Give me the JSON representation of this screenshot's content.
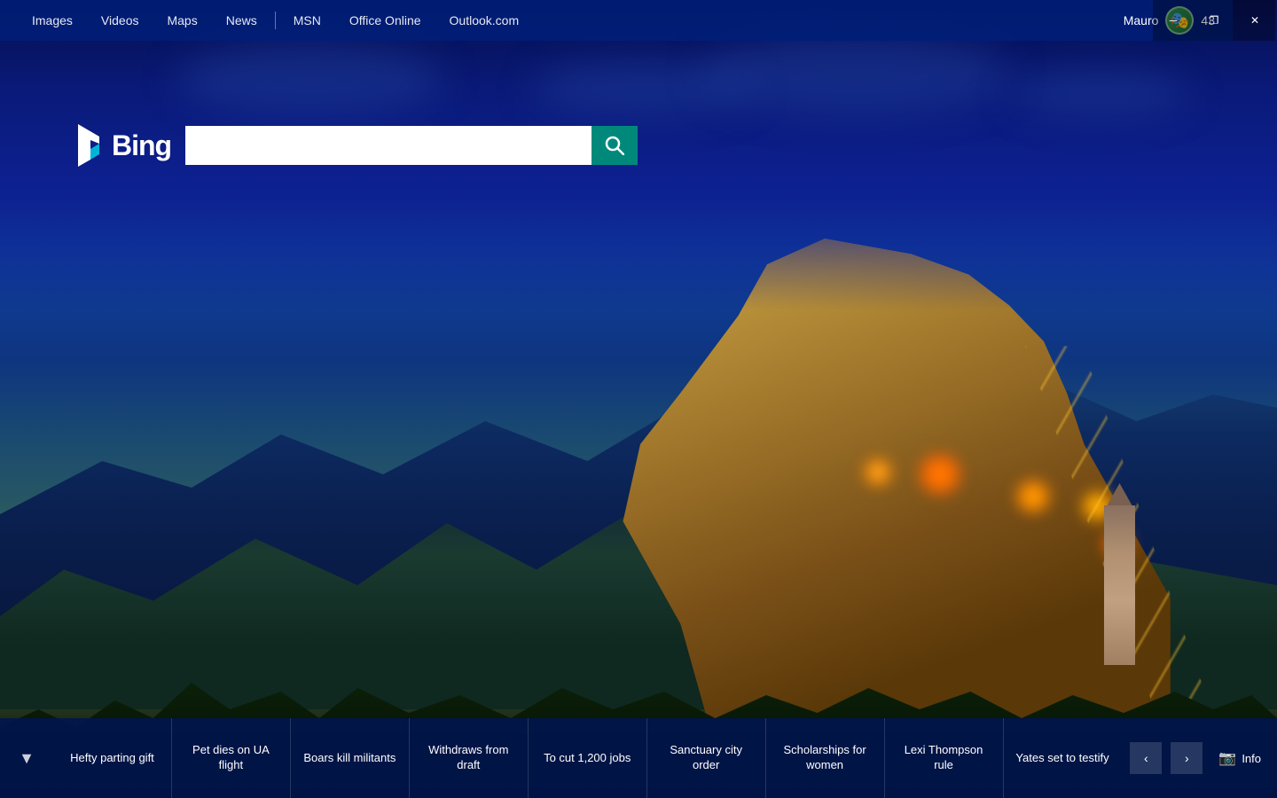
{
  "nav": {
    "items": [
      {
        "label": "Images",
        "id": "nav-images"
      },
      {
        "label": "Videos",
        "id": "nav-videos"
      },
      {
        "label": "Maps",
        "id": "nav-maps"
      },
      {
        "label": "News",
        "id": "nav-news"
      },
      {
        "label": "MSN",
        "id": "nav-msn"
      },
      {
        "label": "Office Online",
        "id": "nav-office"
      },
      {
        "label": "Outlook.com",
        "id": "nav-outlook"
      }
    ],
    "user_name": "Mauro",
    "notification_count": "43"
  },
  "window_controls": {
    "minimize": "─",
    "restore": "❐",
    "close": "✕"
  },
  "search": {
    "logo_text": "Bing",
    "placeholder": "",
    "button_label": "Search"
  },
  "bottom_bar": {
    "toggle_icon": "▼",
    "news_items": [
      {
        "label": "Hefty parting gift",
        "id": "news-1"
      },
      {
        "label": "Pet dies on UA flight",
        "id": "news-2"
      },
      {
        "label": "Boars kill militants",
        "id": "news-3"
      },
      {
        "label": "Withdraws from draft",
        "id": "news-4"
      },
      {
        "label": "To cut 1,200 jobs",
        "id": "news-5"
      },
      {
        "label": "Sanctuary city order",
        "id": "news-6"
      },
      {
        "label": "Scholarships for women",
        "id": "news-7"
      },
      {
        "label": "Lexi Thompson rule",
        "id": "news-8"
      },
      {
        "label": "Yates set to testify",
        "id": "news-9"
      }
    ],
    "nav_prev": "‹",
    "nav_next": "›",
    "info_label": "Info",
    "camera_icon": "📷"
  }
}
